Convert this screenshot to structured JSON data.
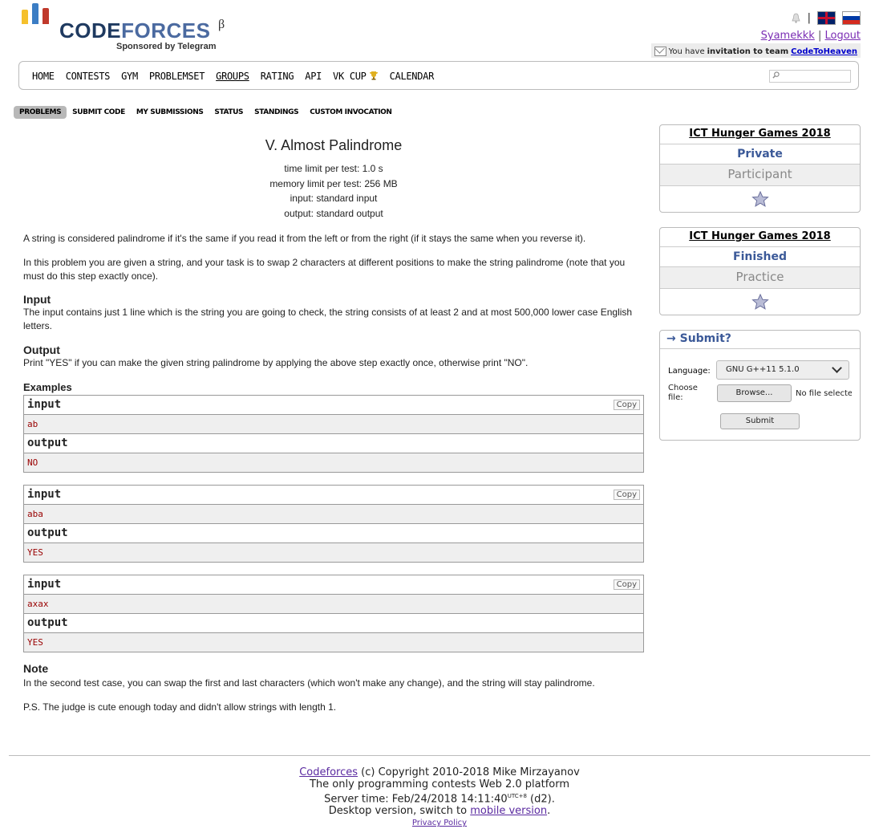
{
  "brand": {
    "code": "CODE",
    "forces": "FORCES",
    "beta": "β",
    "sponsor": "Sponsored by Telegram"
  },
  "header": {
    "separator": "|",
    "username": "Syamekkk",
    "logout": "Logout",
    "invite_prefix": "You have",
    "invite_bold": "invitation to team",
    "invite_team": "CodeToHeaven"
  },
  "nav": {
    "items": [
      "HOME",
      "CONTESTS",
      "GYM",
      "PROBLEMSET",
      "GROUPS",
      "RATING",
      "API",
      "VK CUP",
      "CALENDAR"
    ],
    "active": "GROUPS"
  },
  "subnav": [
    "PROBLEMS",
    "SUBMIT CODE",
    "MY SUBMISSIONS",
    "STATUS",
    "STANDINGS",
    "CUSTOM INVOCATION"
  ],
  "problem": {
    "title": "V. Almost Palindrome",
    "time_limit": "time limit per test: 1.0 s",
    "memory_limit": "memory limit per test: 256 MB",
    "input": "input: standard input",
    "output": "output: standard output",
    "statement1": "A string is considered palindrome if it's the same if you read it from the left or from the right (if it stays the same when you reverse it).",
    "statement2": "In this problem you are given a string, and your task is to swap 2 characters at different positions to make the string palindrome (note that you must do this step exactly once).",
    "input_title": "Input",
    "input_text": "The input contains just 1 line which is the string you are going to check, the string consists of at least 2 and at most 500,000 lower case English letters.",
    "output_title": "Output",
    "output_text": "Print \"YES\" if you can make the given string palindrome by applying the above step exactly once, otherwise print \"NO\".",
    "examples_title": "Examples",
    "input_label": "input",
    "output_label": "output",
    "copy_label": "Copy",
    "examples": [
      {
        "input": "ab",
        "output": "NO"
      },
      {
        "input": "aba",
        "output": "YES"
      },
      {
        "input": "axax",
        "output": "YES"
      }
    ],
    "note_title": "Note",
    "note1": "In the second test case, you can swap the first and last characters (which won't make any change), and the string will stay palindrome.",
    "note2": "P.S. The judge is cute enough today and didn't allow strings with length 1."
  },
  "sidebar": {
    "box1": {
      "title": "ICT Hunger Games 2018",
      "status": "Private",
      "role": "Participant"
    },
    "box2": {
      "title": "ICT Hunger Games 2018",
      "status": "Finished",
      "role": "Practice"
    },
    "submit": {
      "header": "→ Submit?",
      "language_label": "Language:",
      "language_value": "GNU G++11 5.1.0",
      "file_label": "Choose file:",
      "browse": "Browse...",
      "no_file": "No file selected.",
      "submit_button": "Submit"
    }
  },
  "footer": {
    "brand_link": "Codeforces",
    "copyright": " (c) Copyright 2010-2018 Mike Mirzayanov",
    "tagline": "The only programming contests Web 2.0 platform",
    "server_time_prefix": "Server time: Feb/24/2018 14:11:40",
    "utc": "UTC+8",
    "server_time_suffix": " (d2).",
    "desktop_prefix": "Desktop version, switch to ",
    "mobile_link": "mobile version",
    "desktop_suffix": ".",
    "privacy": "Privacy Policy"
  }
}
